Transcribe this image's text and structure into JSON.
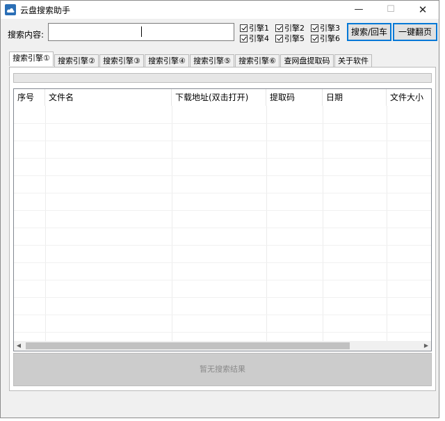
{
  "window": {
    "title": "云盘搜索助手",
    "min_label": "—",
    "max_label": "☐",
    "close_label": "✕"
  },
  "search": {
    "label": "搜索内容:",
    "value": "",
    "placeholder": ""
  },
  "engines": [
    {
      "label": "引擎1",
      "checked": true
    },
    {
      "label": "引擎2",
      "checked": true
    },
    {
      "label": "引擎3",
      "checked": true
    },
    {
      "label": "引擎4",
      "checked": true
    },
    {
      "label": "引擎5",
      "checked": true
    },
    {
      "label": "引擎6",
      "checked": true
    }
  ],
  "buttons": {
    "search": "搜索/回车",
    "next_page": "一键翻页"
  },
  "tabs": [
    {
      "label": "搜索引擎①",
      "active": true
    },
    {
      "label": "搜索引擎②",
      "active": false
    },
    {
      "label": "搜索引擎③",
      "active": false
    },
    {
      "label": "搜索引擎④",
      "active": false
    },
    {
      "label": "搜索引擎⑤",
      "active": false
    },
    {
      "label": "搜索引擎⑥",
      "active": false
    },
    {
      "label": "查网盘提取码",
      "active": false
    },
    {
      "label": "关于软件",
      "active": false
    }
  ],
  "progress": 0,
  "table": {
    "columns": [
      "序号",
      "文件名",
      "下载地址(双击打开)",
      "提取码",
      "日期",
      "文件大小"
    ],
    "rows": []
  },
  "status_text": "暂无搜索结果",
  "colors": {
    "accent": "#0078d7",
    "window_bg": "#f0f0f0",
    "status_bg": "#cccccc"
  }
}
